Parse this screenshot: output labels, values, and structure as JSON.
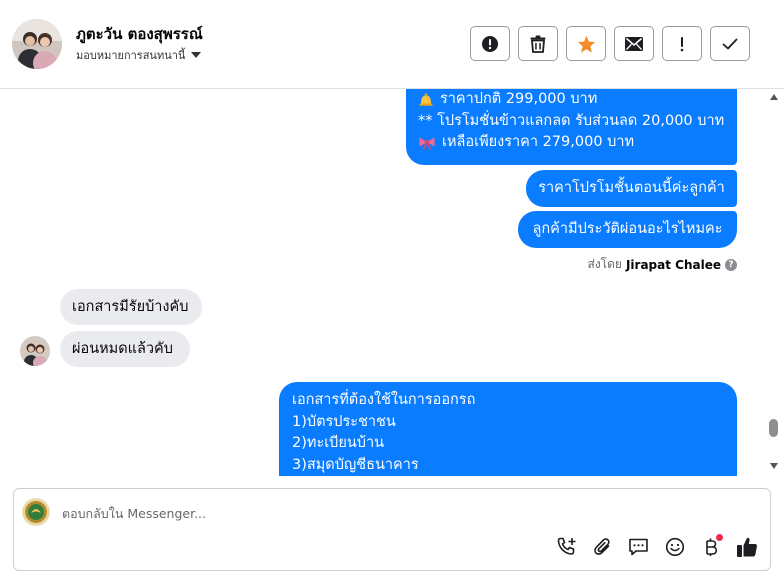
{
  "header": {
    "contact_name": "ภูตะวัน ตองสุพรรณ์",
    "assign_label": "มอบหมายการสนทนานี้",
    "actions": [
      {
        "name": "mark-spam-button",
        "icon": "alert-circle-icon"
      },
      {
        "name": "delete-button",
        "icon": "trash-icon"
      },
      {
        "name": "star-button",
        "icon": "star-icon"
      },
      {
        "name": "mark-unread-button",
        "icon": "envelope-icon"
      },
      {
        "name": "follow-up-button",
        "icon": "exclamation-icon"
      },
      {
        "name": "mark-done-button",
        "icon": "checkmark-icon"
      }
    ],
    "star_color": "#f28c28"
  },
  "messages": {
    "outgoing_promo": {
      "line1_icon": "bell-icon",
      "line1_text": "ราคาปกติ 299,000 บาท",
      "line2_text": "** โปรโมชั่นข้าวแลกลด รับส่วนลด 20,000 บาท",
      "line3_icon": "ribbon-icon",
      "line3_text": "เหลือเพียงราคา 279,000 บาท"
    },
    "outgoing_2": "ราคาโปรโมชั้นตอนนี้ค่ะลูกค้า",
    "outgoing_3": "ลูกค้ามีประวัติผ่อนอะไรไหมคะ",
    "sent_by_prefix": "ส่งโดย",
    "sent_by_name": "Jirapat Chalee",
    "incoming_1": "เอกสารมีรัยบ้างคับ",
    "incoming_2": "ผ่อนหมดแล้วคับ",
    "outgoing_docs": {
      "title": "เอกสารที่ต้องใช้ในการออกรถ",
      "items": [
        "1)บัตรประชาชน",
        "2)ทะเบียนบ้าน",
        "3)สมุดบัญชีธนาคาร"
      ]
    }
  },
  "composer": {
    "placeholder": "ตอบกลับใน Messenger...",
    "value": "",
    "tools": [
      "call-add-icon",
      "paperclip-icon",
      "saved-reply-icon",
      "emoji-icon",
      "baht-icon",
      "thumbs-up-icon"
    ],
    "notification_dot_color": "#f02849"
  },
  "colors": {
    "outgoing_bubble": "#0a7cff",
    "incoming_bubble": "#e9ebee"
  }
}
